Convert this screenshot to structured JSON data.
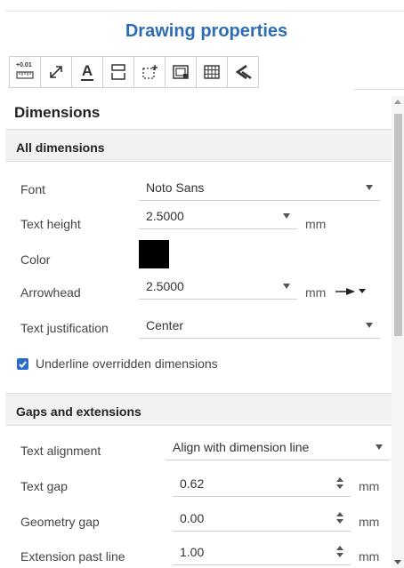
{
  "title": "Drawing properties",
  "tabs": [
    {
      "name": "units-tab",
      "icon": "ruler-units-icon",
      "badge": "+0.01"
    },
    {
      "name": "dimensions-tab",
      "icon": "dimension-arrow-icon"
    },
    {
      "name": "text-tab",
      "icon": "text-underline-icon",
      "glyph": "A"
    },
    {
      "name": "tables-tab",
      "icon": "table-header-icon"
    },
    {
      "name": "datum-tab",
      "icon": "datum-add-icon"
    },
    {
      "name": "views-tab",
      "icon": "view-frame-icon"
    },
    {
      "name": "grid-tab",
      "icon": "grid-icon"
    },
    {
      "name": "callout-tab",
      "icon": "callout-check-icon"
    }
  ],
  "section_title": "Dimensions",
  "all_dimensions": {
    "heading": "All dimensions",
    "font": {
      "label": "Font",
      "value": "Noto Sans"
    },
    "text_height": {
      "label": "Text height",
      "value": "2.5000",
      "unit": "mm"
    },
    "color": {
      "label": "Color",
      "value": "#000000"
    },
    "arrowhead": {
      "label": "Arrowhead",
      "value": "2.5000",
      "unit": "mm",
      "style_icon": "arrow-style-icon"
    },
    "text_justification": {
      "label": "Text justification",
      "value": "Center"
    },
    "underline": {
      "label": "Underline overridden dimensions",
      "checked": true
    }
  },
  "gaps": {
    "heading": "Gaps and extensions",
    "text_alignment": {
      "label": "Text alignment",
      "value": "Align with dimension line"
    },
    "text_gap": {
      "label": "Text gap",
      "value": "0.62",
      "unit": "mm"
    },
    "geometry_gap": {
      "label": "Geometry gap",
      "value": "0.00",
      "unit": "mm"
    },
    "extension_past_line": {
      "label": "Extension past line",
      "value": "1.00",
      "unit": "mm"
    }
  }
}
